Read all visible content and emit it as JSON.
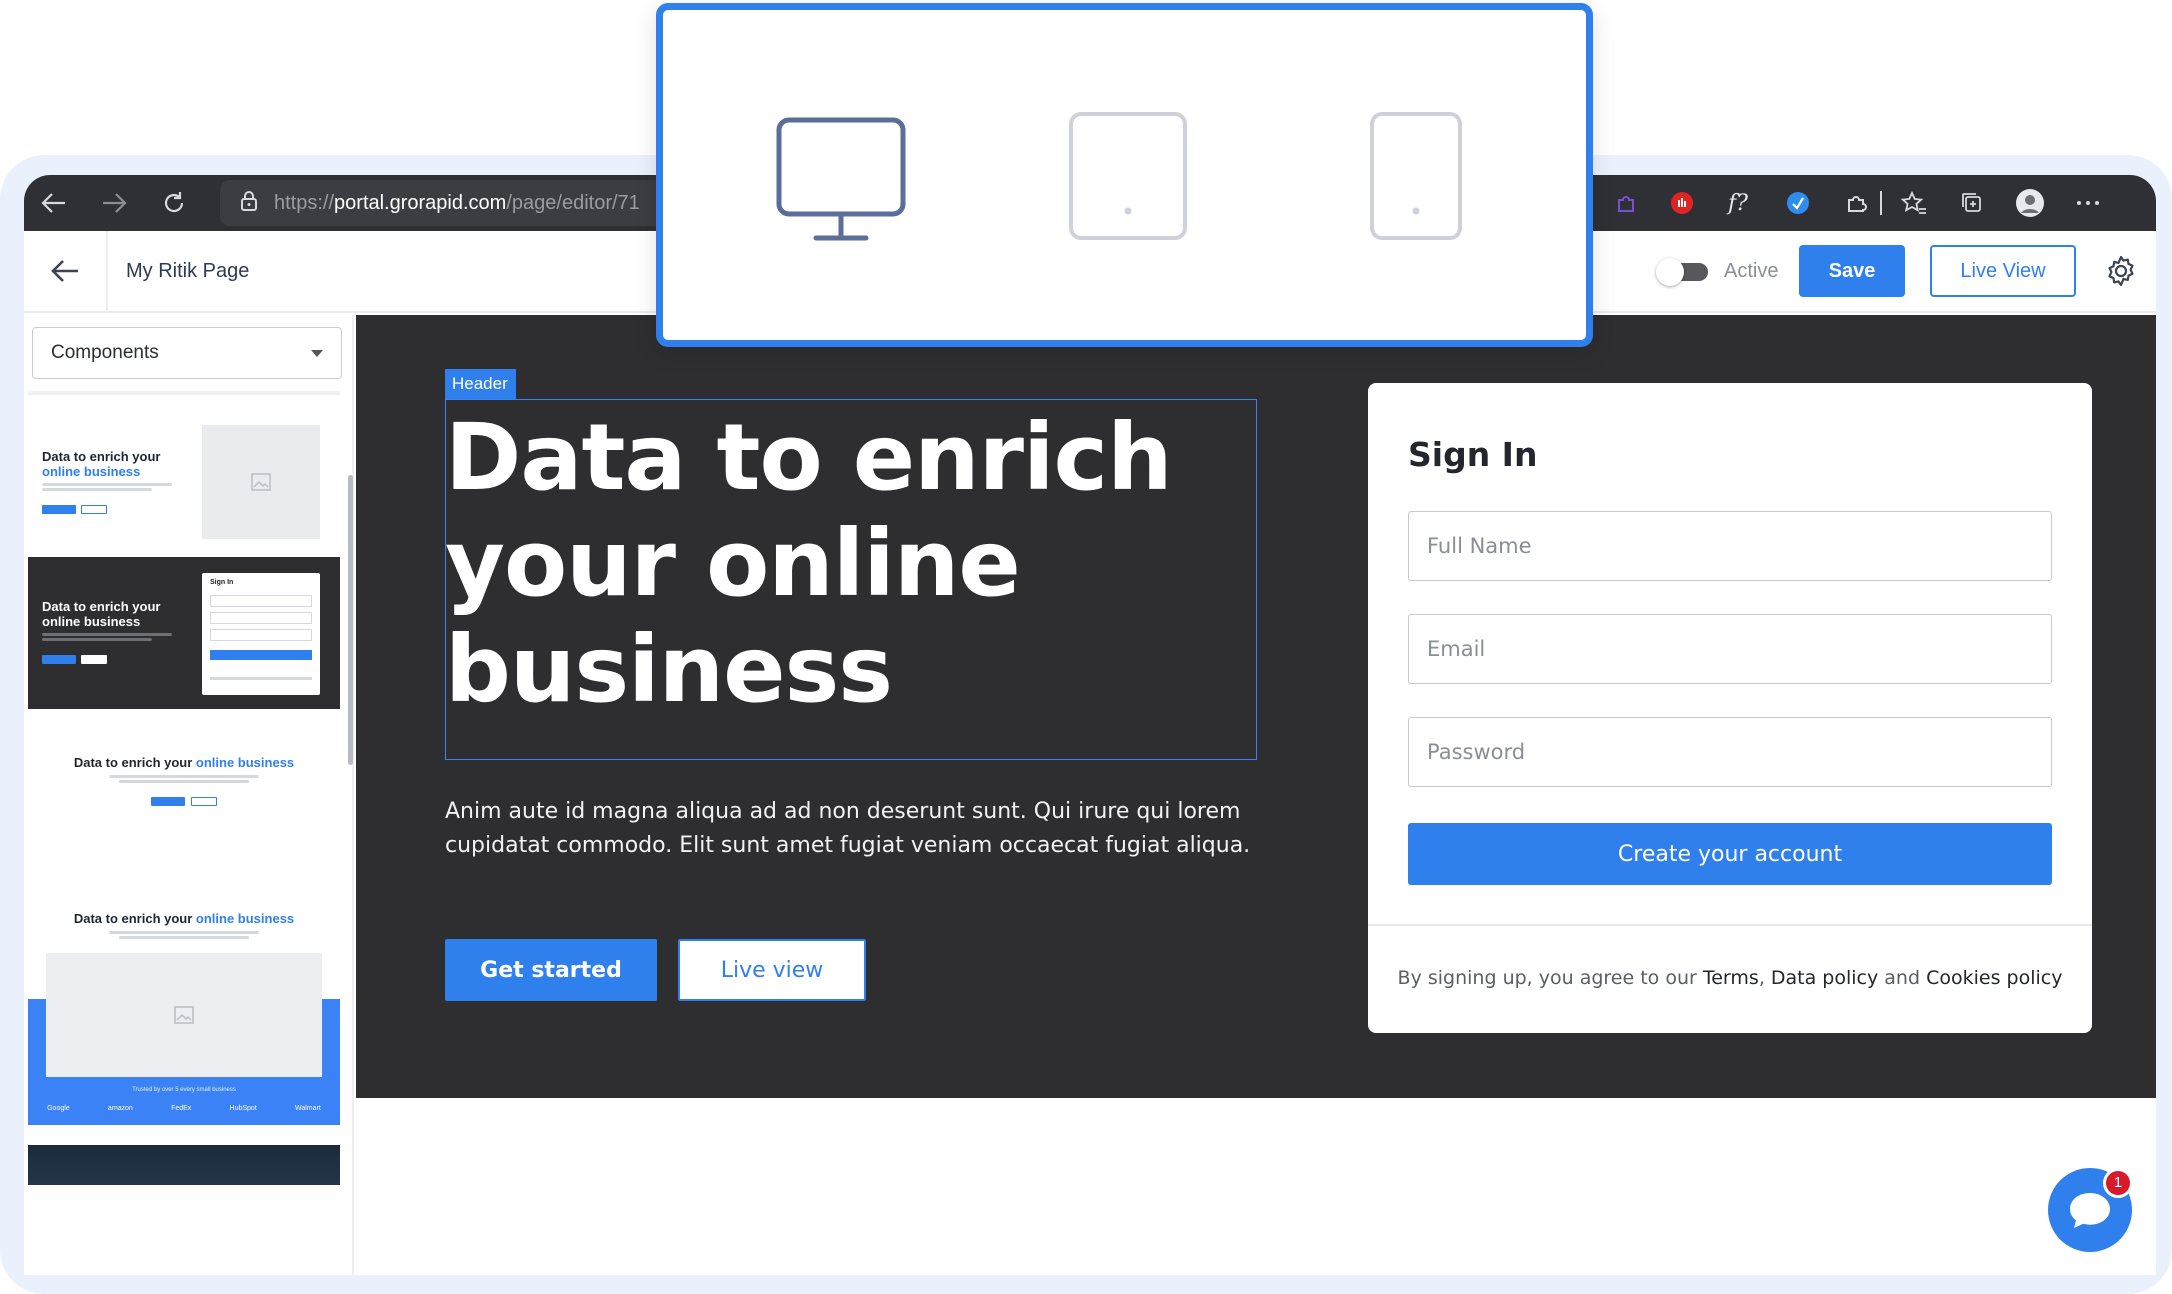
{
  "browser": {
    "url": "https://portal.grorapid.com/page/editor/71",
    "url_host": "portal.grorapid.com",
    "url_path": "/page/editor/71",
    "url_scheme": "https://"
  },
  "header": {
    "page_name": "My Ritik Page",
    "active_label": "Active",
    "save_label": "Save",
    "live_view_label": "Live View"
  },
  "sidebar": {
    "select_value": "Components",
    "thumbnails": [
      {
        "title_a": "Data to enrich your",
        "title_b": "online business"
      },
      {
        "title_a": "Data to enrich your",
        "title_b": "online business",
        "form_title": "Sign In"
      },
      {
        "title_a": "Data to enrich your ",
        "title_b": "online business"
      },
      {
        "title_a": "Data to enrich your ",
        "title_b": "online business",
        "footer_text": "Trusted by over 5 every small business",
        "logos": [
          "Google",
          "amazon",
          "FedEx",
          "HubSpot",
          "Walmart"
        ]
      }
    ]
  },
  "hero": {
    "tag": "Header",
    "headline": "Data to enrich your online business",
    "subtext": "Anim aute id magna aliqua ad ad non deserunt sunt. Qui irure qui lorem cupidatat commodo. Elit sunt amet fugiat veniam occaecat fugiat aliqua.",
    "get_started": "Get started",
    "live_view": "Live view"
  },
  "signin": {
    "title": "Sign In",
    "full_name_placeholder": "Full Name",
    "email_placeholder": "Email",
    "password_placeholder": "Password",
    "create_label": "Create your account",
    "terms_prefix": "By signing up, you agree to our ",
    "terms_link": "Terms",
    "terms_sep": ", ",
    "data_policy": "Data policy",
    "terms_and": " and ",
    "cookies_policy": "Cookies policy"
  },
  "devices": [
    "desktop-icon",
    "tablet-icon",
    "mobile-icon"
  ],
  "chat": {
    "badge": "1"
  },
  "colors": {
    "accent": "#2f80ed",
    "hero_bg": "#2e2e31",
    "browser_bar": "#2f3035"
  }
}
